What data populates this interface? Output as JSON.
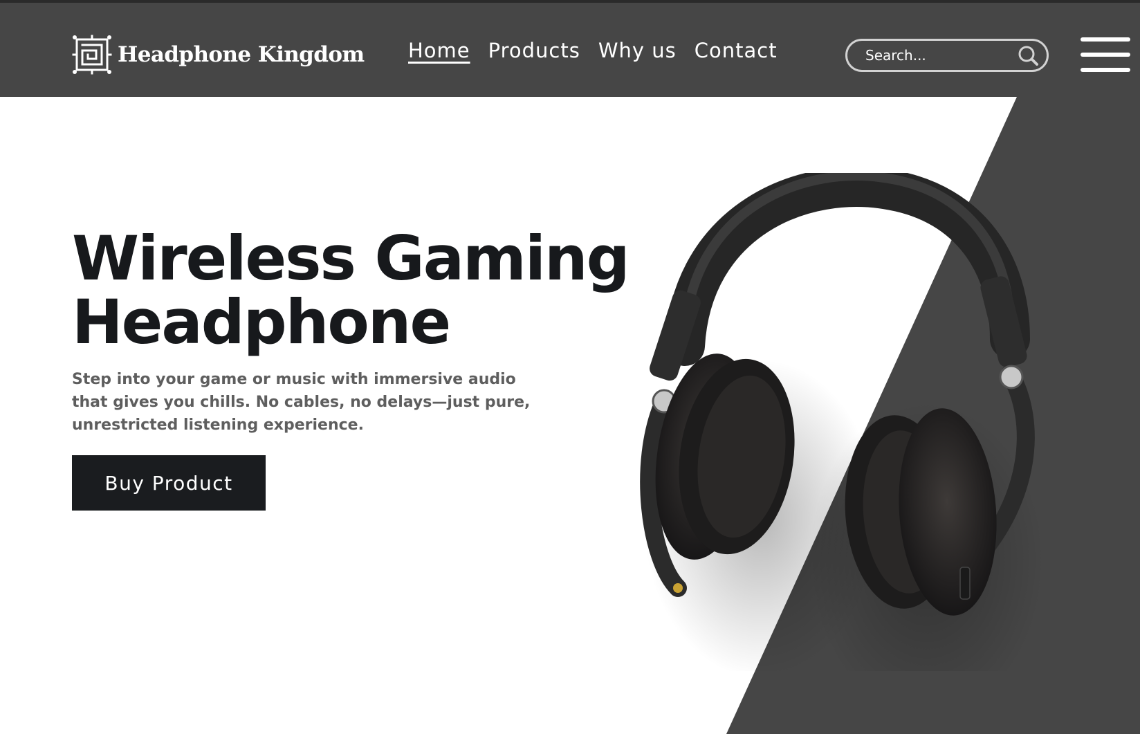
{
  "brand": {
    "name": "Headphone Kingdom",
    "logo_icon": "maze-logo-icon"
  },
  "nav": {
    "links": [
      {
        "label": "Home",
        "active": true
      },
      {
        "label": "Products",
        "active": false
      },
      {
        "label": "Why us",
        "active": false
      },
      {
        "label": "Contact",
        "active": false
      }
    ]
  },
  "search": {
    "placeholder": "Search...",
    "value": "",
    "icon": "search-icon"
  },
  "menu": {
    "icon": "hamburger-menu-icon"
  },
  "hero": {
    "title_line1": "Wireless Gaming",
    "title_line2": "Headphone",
    "description": "Step into your game or music with immersive audio that gives you chills. No cables, no delays—just pure, unrestricted listening experience.",
    "cta_label": "Buy Product",
    "image": "headphones-image"
  },
  "colors": {
    "navbar": "#464646",
    "hero_accent": "#464646",
    "title": "#17191c",
    "body_text": "#5e5e5e",
    "button": "#1a1c1f"
  }
}
